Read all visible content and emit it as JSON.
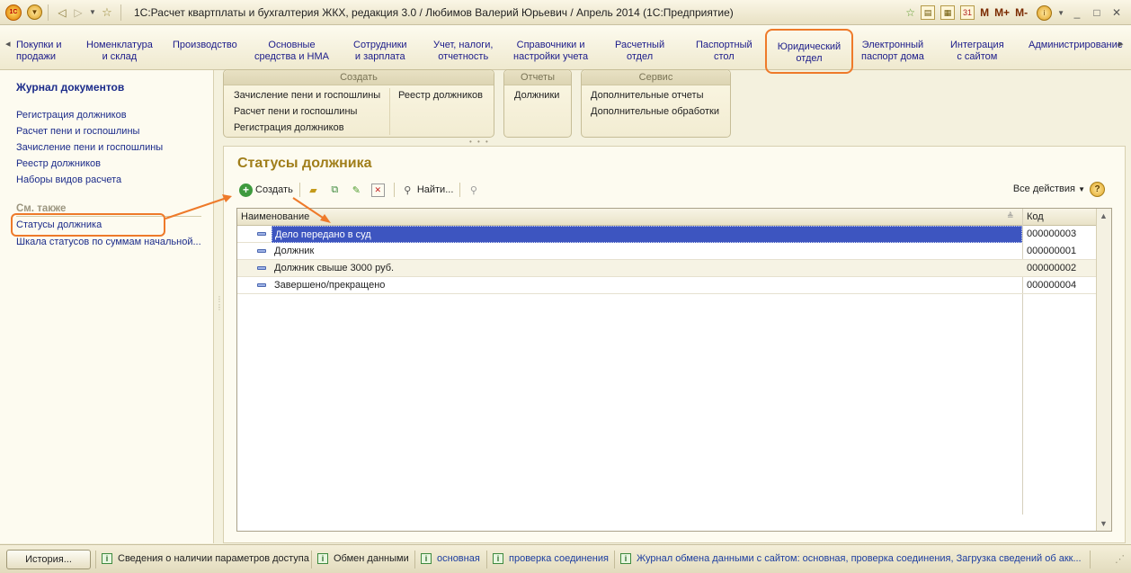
{
  "window": {
    "title": "1С:Расчет квартплаты и бухгалтерия ЖКХ, редакция 3.0 / Любимов Валерий Юрьевич / Апрель 2014  (1С:Предприятие)",
    "memory_buttons": [
      "M",
      "M+",
      "M-"
    ]
  },
  "sections": [
    {
      "label": "Покупки и\nпродажи"
    },
    {
      "label": "Номенклатура\nи склад"
    },
    {
      "label": "Производство"
    },
    {
      "label": "Основные\nсредства и НМА"
    },
    {
      "label": "Сотрудники\nи зарплата"
    },
    {
      "label": "Учет, налоги,\nотчетность"
    },
    {
      "label": "Справочники и\nнастройки учета"
    },
    {
      "label": "Расчетный\nотдел"
    },
    {
      "label": "Паспортный\nстол"
    },
    {
      "label": "Юридический\nотдел"
    },
    {
      "label": "Электронный\nпаспорт дома"
    },
    {
      "label": "Интеграция\nс сайтом"
    },
    {
      "label": "Администрирование"
    }
  ],
  "left_panel": {
    "journal_title": "Журнал документов",
    "links": [
      "Регистрация должников",
      "Расчет пени и госпошлины",
      "Зачисление пени и госпошлины",
      "Реестр должников",
      "Наборы видов расчета"
    ],
    "see_also_title": "См. также",
    "see_also": [
      "Статусы должника",
      "Шкала статусов по суммам начальной..."
    ]
  },
  "command_groups": {
    "create": {
      "title": "Создать",
      "items": [
        "Зачисление пени и госпошлины",
        "Расчет пени и госпошлины",
        "Регистрация должников",
        "Реестр должников"
      ]
    },
    "reports": {
      "title": "Отчеты",
      "items": [
        "Должники"
      ]
    },
    "service": {
      "title": "Сервис",
      "items": [
        "Дополнительные отчеты",
        "Дополнительные обработки"
      ]
    }
  },
  "form": {
    "title": "Статусы должника",
    "toolbar": {
      "create": "Создать",
      "find": "Найти...",
      "all_actions": "Все действия"
    },
    "columns": {
      "name": "Наименование",
      "code": "Код"
    },
    "rows": [
      {
        "name": "Дело передано в суд",
        "code": "000000003",
        "selected": true
      },
      {
        "name": "Должник",
        "code": "000000001",
        "selected": false
      },
      {
        "name": "Должник свыше 3000 руб.",
        "code": "000000002",
        "selected": false
      },
      {
        "name": "Завершено/прекращено",
        "code": "000000004",
        "selected": false
      }
    ]
  },
  "status_bar": {
    "history_button": "История...",
    "items": [
      "Сведения о наличии параметров доступа",
      "Обмен данными",
      "основная",
      "проверка соединения",
      "Журнал обмена данными с сайтом: основная, проверка соединения, Загрузка сведений об акк..."
    ]
  },
  "colors": {
    "highlight": "#ee7a2a",
    "link": "#1b2b8a",
    "form_title": "#a07e1a",
    "selection": "#3d55c0"
  }
}
